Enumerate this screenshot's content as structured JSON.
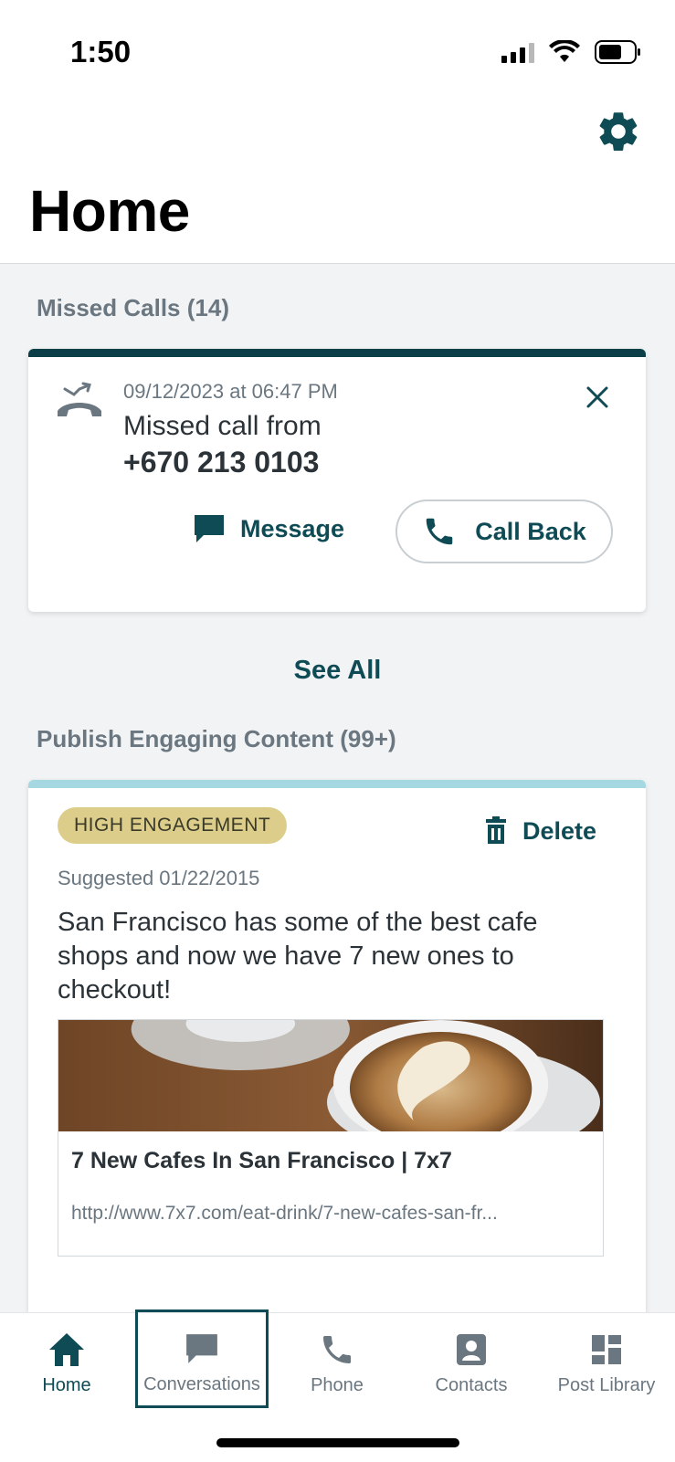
{
  "status_bar": {
    "time": "1:50"
  },
  "header": {
    "title": "Home",
    "settings_icon": "gear-icon"
  },
  "missed_calls": {
    "heading": "Missed Calls (14)",
    "item": {
      "date": "09/12/2023 at 06:47 PM",
      "text": "Missed call from",
      "number": "+670 213 0103"
    },
    "message_label": "Message",
    "call_back_label": "Call Back",
    "see_all_label": "See All"
  },
  "publish": {
    "heading": "Publish Engaging Content (99+)",
    "post": {
      "badge": "HIGH ENGAGEMENT",
      "delete_label": "Delete",
      "suggested": "Suggested 01/22/2015",
      "text": "San Francisco has some of the best cafe shops and now we have 7 new ones to checkout!",
      "link_title": "7 New Cafes In San Francisco | 7x7",
      "link_url": "http://www.7x7.com/eat-drink/7-new-cafes-san-fr..."
    }
  },
  "tabs": [
    {
      "label": "Home",
      "icon": "home-icon",
      "active": true
    },
    {
      "label": "Conversations",
      "icon": "chat-icon"
    },
    {
      "label": "Phone",
      "icon": "phone-icon"
    },
    {
      "label": "Contacts",
      "icon": "contact-card-icon"
    },
    {
      "label": "Post Library",
      "icon": "dashboard-icon"
    }
  ],
  "colors": {
    "accent": "#0f4b55",
    "missed_bar": "#0d3f48",
    "publish_bar": "#a5d8e1",
    "badge": "#dccd8a",
    "background": "#f1f3f5"
  }
}
